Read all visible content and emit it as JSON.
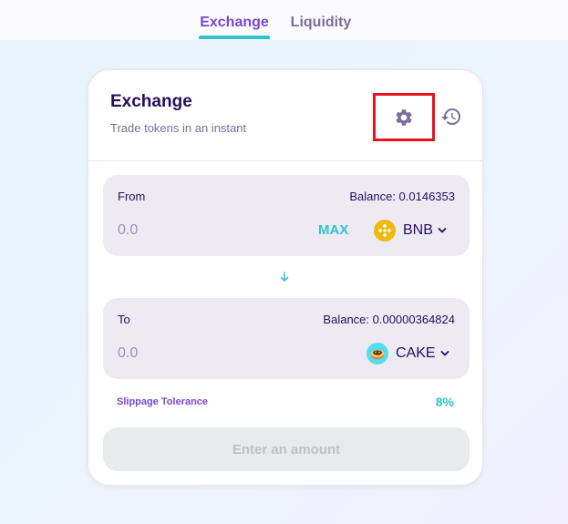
{
  "nav": {
    "tabs": [
      {
        "label": "Exchange",
        "active": true
      },
      {
        "label": "Liquidity",
        "active": false
      }
    ]
  },
  "card": {
    "title": "Exchange",
    "subtitle": "Trade tokens in an instant",
    "settings_icon": "gear-icon",
    "history_icon": "history-icon"
  },
  "from": {
    "label": "From",
    "balance": "Balance: 0.0146353",
    "amount_placeholder": "0.0",
    "max_label": "MAX",
    "token": "BNB",
    "token_icon": "bnb-icon"
  },
  "to": {
    "label": "To",
    "balance": "Balance: 0.00000364824",
    "amount_placeholder": "0.0",
    "token": "CAKE",
    "token_icon": "cake-icon"
  },
  "slippage": {
    "label": "Slippage Tolerance",
    "value": "8%"
  },
  "action": {
    "label": "Enter an amount"
  },
  "colors": {
    "accent_purple": "#7a45d1",
    "accent_teal": "#31c4cf",
    "text_dark": "#280d5f",
    "highlight_border": "#e8131c"
  }
}
